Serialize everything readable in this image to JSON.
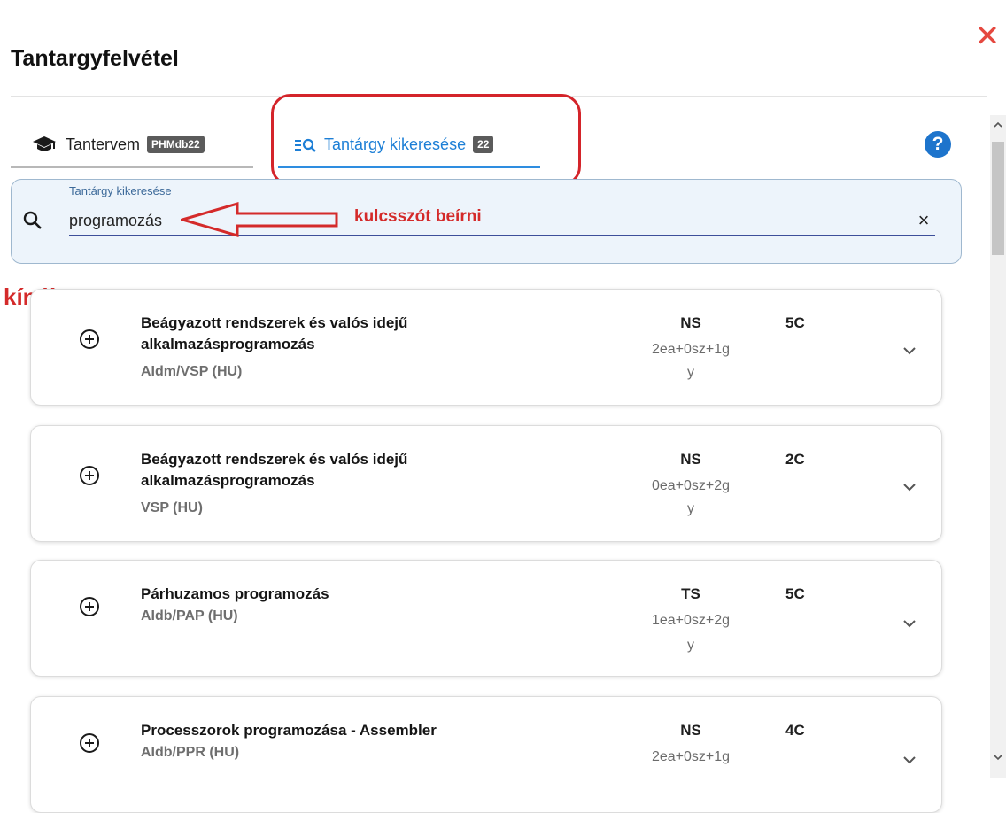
{
  "dialog": {
    "title": "Tantargyfelvétel",
    "close_symbol": "✕"
  },
  "tabs": [
    {
      "label": "Tantervem",
      "badge": "PHMdb22",
      "icon": "graduation-cap-icon"
    },
    {
      "label": "Tantárgy kikeresése",
      "badge": "22",
      "icon": "list-search-icon",
      "active": true
    }
  ],
  "help": {
    "symbol": "?"
  },
  "search": {
    "label": "Tantárgy kikeresése",
    "value": "programozás",
    "clear_symbol": "×"
  },
  "annotations": {
    "keyword_hint": "kulcsszót beírni",
    "offer_label": "kínálat:",
    "color": "#d42a2a"
  },
  "results": [
    {
      "title": "Beágyazott rendszerek és valós idejű alkalmazásprogramozás",
      "code": "AIdm/VSP (HU)",
      "type": "NS",
      "hours_line1": "2ea+0sz+1g",
      "hours_line2": "y",
      "credits": "5C"
    },
    {
      "title": "Beágyazott rendszerek és valós idejű alkalmazásprogramozás",
      "code": "VSP (HU)",
      "type": "NS",
      "hours_line1": "0ea+0sz+2g",
      "hours_line2": "y",
      "credits": "2C"
    },
    {
      "title": "Párhuzamos programozás",
      "code": "AIdb/PAP (HU)",
      "type": "TS",
      "hours_line1": "1ea+0sz+2g",
      "hours_line2": "y",
      "credits": "5C"
    },
    {
      "title": "Processzorok programozása - Assembler",
      "code": "AIdb/PPR (HU)",
      "type": "NS",
      "hours_line1": "2ea+0sz+1g",
      "hours_line2": "",
      "credits": "4C"
    }
  ],
  "colors": {
    "accent": "#1d7fd6",
    "close": "#e5483f",
    "annotation": "#d42a2a"
  }
}
